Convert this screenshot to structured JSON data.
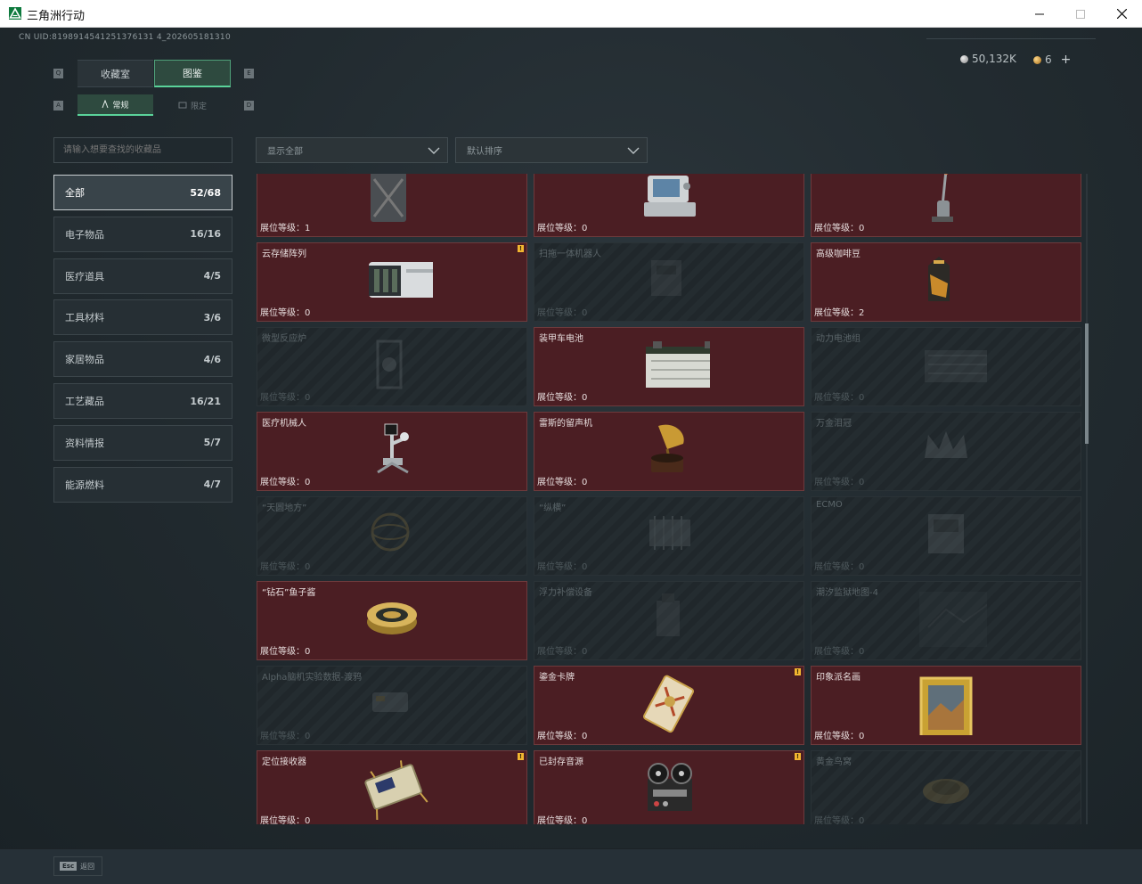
{
  "window": {
    "title": "三角洲行动"
  },
  "header": {
    "uid": "CN UID:8198914541251376131 4_202605181310",
    "silver": "50,132K",
    "gold": "6",
    "plus": "+"
  },
  "tabs": {
    "key_left": "Q",
    "key_right": "E",
    "collection": "收藏室",
    "atlas": "图鉴"
  },
  "subtabs": {
    "key_left": "A",
    "key_right": "D",
    "normal": "常规",
    "limited": "限定"
  },
  "search": {
    "placeholder": "请输入想要查找的收藏品"
  },
  "filters": {
    "show": "显示全部",
    "sort": "默认排序"
  },
  "categories": [
    {
      "label": "全部",
      "count": "52/68"
    },
    {
      "label": "电子物品",
      "count": "16/16"
    },
    {
      "label": "医疗道具",
      "count": "4/5"
    },
    {
      "label": "工具材料",
      "count": "3/6"
    },
    {
      "label": "家居物品",
      "count": "4/6"
    },
    {
      "label": "工艺藏品",
      "count": "16/21"
    },
    {
      "label": "资料情报",
      "count": "5/7"
    },
    {
      "label": "能源燃料",
      "count": "4/7"
    }
  ],
  "items": [
    {
      "name": "",
      "level": "展位等级：1",
      "unlocked": true,
      "badge": false,
      "icon": "jerrycan-icon"
    },
    {
      "name": "",
      "level": "展位等级：0",
      "unlocked": true,
      "badge": false,
      "icon": "medical-monitor-icon"
    },
    {
      "name": "",
      "level": "展位等级：0",
      "unlocked": true,
      "badge": false,
      "icon": "floor-washer-icon"
    },
    {
      "name": "云存储阵列",
      "level": "展位等级：0",
      "unlocked": true,
      "badge": true,
      "icon": "storage-array-icon"
    },
    {
      "name": "扫拖一体机器人",
      "level": "展位等级：0",
      "unlocked": false,
      "badge": false,
      "icon": "robot-vacuum-icon"
    },
    {
      "name": "高级咖啡豆",
      "level": "展位等级：2",
      "unlocked": true,
      "badge": false,
      "icon": "coffee-bag-icon"
    },
    {
      "name": "微型反应炉",
      "level": "展位等级：0",
      "unlocked": false,
      "badge": false,
      "icon": "reactor-icon"
    },
    {
      "name": "装甲车电池",
      "level": "展位等级：0",
      "unlocked": true,
      "badge": false,
      "icon": "battery-icon"
    },
    {
      "name": "动力电池组",
      "level": "展位等级：0",
      "unlocked": false,
      "badge": false,
      "icon": "battery-pack-icon"
    },
    {
      "name": "医疗机械人",
      "level": "展位等级：0",
      "unlocked": true,
      "badge": false,
      "icon": "medical-robot-icon"
    },
    {
      "name": "雷斯的留声机",
      "level": "展位等级：0",
      "unlocked": true,
      "badge": false,
      "icon": "gramophone-icon"
    },
    {
      "name": "万金泪冠",
      "level": "展位等级：0",
      "unlocked": false,
      "badge": false,
      "icon": "crown-icon"
    },
    {
      "name": "“天圆地方”",
      "level": "展位等级：0",
      "unlocked": false,
      "badge": false,
      "icon": "armillary-icon"
    },
    {
      "name": "“纵横”",
      "level": "展位等级：0",
      "unlocked": false,
      "badge": false,
      "icon": "chip-icon"
    },
    {
      "name": "ECMO",
      "level": "展位等级：0",
      "unlocked": false,
      "badge": false,
      "icon": "ecmo-icon"
    },
    {
      "name": "“钻石”鱼子酱",
      "level": "展位等级：0",
      "unlocked": true,
      "badge": false,
      "icon": "caviar-tin-icon"
    },
    {
      "name": "浮力补偿设备",
      "level": "展位等级：0",
      "unlocked": false,
      "badge": false,
      "icon": "buoyancy-vest-icon"
    },
    {
      "name": "潮汐监狱地图-4",
      "level": "展位等级：0",
      "unlocked": false,
      "badge": false,
      "icon": "map-icon"
    },
    {
      "name": "Alpha脑机实验数据-渡鸦",
      "level": "展位等级：0",
      "unlocked": false,
      "badge": false,
      "icon": "data-drive-icon"
    },
    {
      "name": "鎏金卡牌",
      "level": "展位等级：0",
      "unlocked": true,
      "badge": true,
      "icon": "gold-card-icon"
    },
    {
      "name": "印象派名画",
      "level": "展位等级：0",
      "unlocked": true,
      "badge": false,
      "icon": "painting-icon"
    },
    {
      "name": "定位接收器",
      "level": "展位等级：0",
      "unlocked": true,
      "badge": true,
      "icon": "receiver-icon"
    },
    {
      "name": "已封存音源",
      "level": "展位等级：0",
      "unlocked": true,
      "badge": true,
      "icon": "reel-recorder-icon"
    },
    {
      "name": "黄金鸟窝",
      "level": "展位等级：0",
      "unlocked": false,
      "badge": false,
      "icon": "gold-nest-icon"
    }
  ],
  "footer": {
    "esc_key": "Esc",
    "esc_label": "返回"
  },
  "colors": {
    "accent": "#5ad39a",
    "unlocked_bg": "#4b1e23",
    "badge": "#f2b630"
  }
}
